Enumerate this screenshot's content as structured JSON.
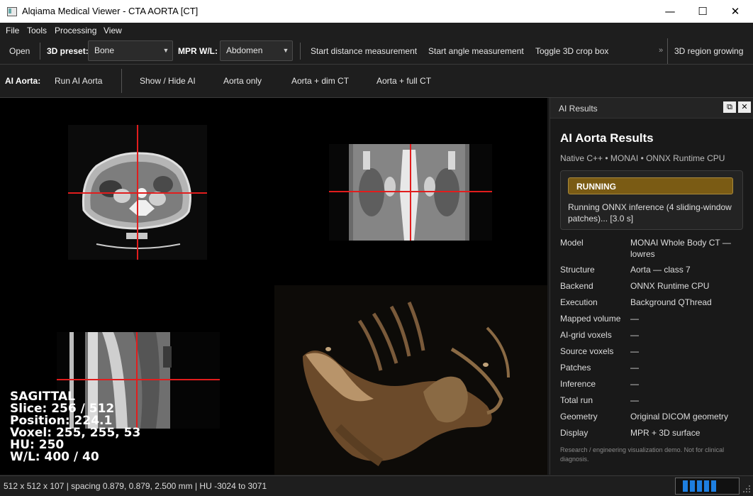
{
  "window": {
    "title": "Alqiama Medical Viewer - CTA AORTA [CT]",
    "minimize": "—",
    "maximize": "☐",
    "close": "✕"
  },
  "menu": [
    "File",
    "Tools",
    "Processing",
    "View"
  ],
  "toolbar1": {
    "open": "Open",
    "preset_label": "3D preset:",
    "preset_value": "Bone",
    "mpr_label": "MPR W/L:",
    "mpr_value": "Abdomen",
    "distance": "Start distance measurement",
    "angle": "Start angle measurement",
    "crop": "Toggle 3D crop box",
    "more": "»",
    "region": "3D region growing"
  },
  "toolbar2": {
    "label": "AI Aorta:",
    "run": "Run AI Aorta",
    "showhide": "Show / Hide AI",
    "aorta_only": "Aorta only",
    "dim_ct": "Aorta + dim CT",
    "full_ct": "Aorta + full CT"
  },
  "overlay": {
    "view": "SAGITTAL",
    "slice": "Slice: 256 / 512",
    "position": "Position: 224.1",
    "voxel": "Voxel: 255, 255, 53",
    "hu": "HU: 250",
    "wl": "W/L: 400 / 40"
  },
  "panel": {
    "dock_title": "AI Results",
    "heading": "AI Aorta Results",
    "subtitle": "Native C++ • MONAI • ONNX Runtime CPU",
    "status": "RUNNING",
    "status_text": "Running ONNX inference (4 sliding-window patches)...  [3.0 s]",
    "rows": [
      {
        "key": "Model",
        "value": "MONAI Whole Body CT — lowres"
      },
      {
        "key": "Structure",
        "value": "Aorta — class 7"
      },
      {
        "key": "Backend",
        "value": "ONNX Runtime CPU"
      },
      {
        "key": "Execution",
        "value": "Background QThread"
      },
      {
        "key": "Mapped volume",
        "value": "—"
      },
      {
        "key": "AI-grid voxels",
        "value": "—"
      },
      {
        "key": "Source voxels",
        "value": "—"
      },
      {
        "key": "Patches",
        "value": "—"
      },
      {
        "key": "Inference",
        "value": "—"
      },
      {
        "key": "Total run",
        "value": "—"
      },
      {
        "key": "Geometry",
        "value": "Original DICOM geometry"
      },
      {
        "key": "Display",
        "value": "MPR + 3D surface"
      }
    ],
    "footnote": "Research / engineering visualization demo. Not for clinical diagnosis."
  },
  "statusbar": {
    "text": "512 x 512 x 107 | spacing 0.879, 0.879, 2.500 mm | HU -3024 to 3071",
    "progress_segments": 5
  },
  "colors": {
    "crosshair": "#e11d1d",
    "running_badge": "#7a5b14",
    "progress": "#1e7fe0"
  }
}
